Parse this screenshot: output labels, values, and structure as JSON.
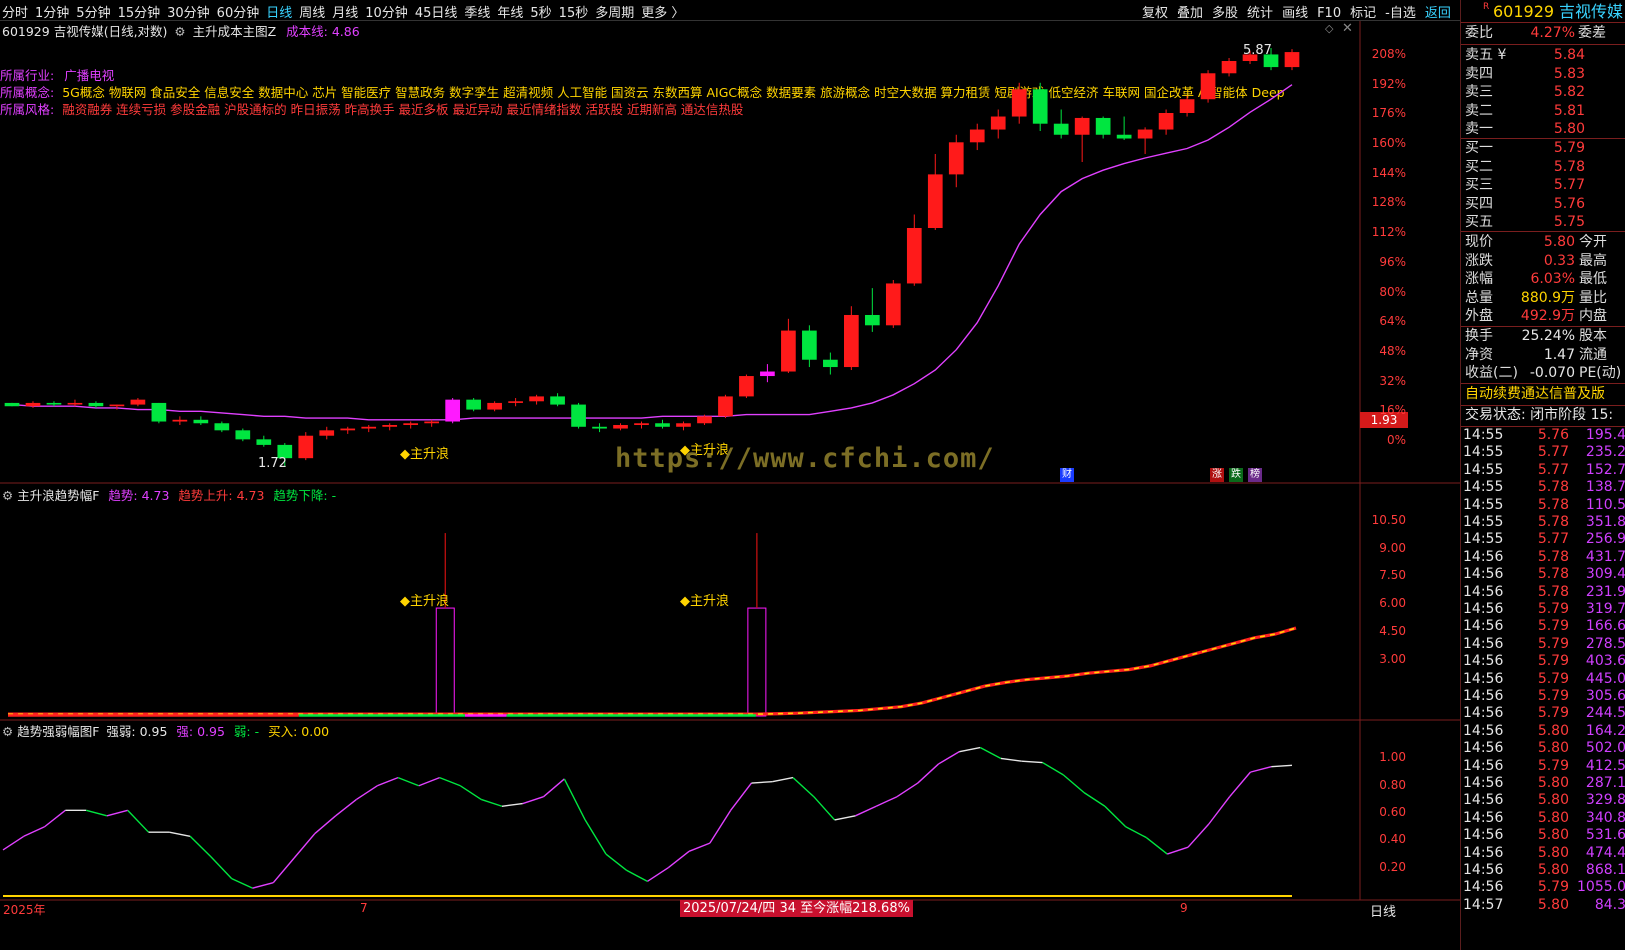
{
  "toolbar": {
    "periods": [
      "分时",
      "1分钟",
      "5分钟",
      "15分钟",
      "30分钟",
      "60分钟",
      "日线",
      "周线",
      "月线",
      "10分钟",
      "45日线",
      "季线",
      "年线",
      "5秒",
      "15秒",
      "多周期",
      "更多 〉"
    ],
    "active_period": "日线",
    "tools": [
      "复权",
      "叠加",
      "多股",
      "统计",
      "画线",
      "F10",
      "标记",
      "-自选",
      "返回"
    ]
  },
  "main_chart": {
    "stock_line": "601929 吉视传媒(日线,对数)",
    "indicator": "主升成本主图Z",
    "cost_label": "成本线: 4.86",
    "industry_label": "所属行业:",
    "industry_value": "广播电视",
    "concept_label": "所属概念:",
    "concept_value": "5G概念 物联网 食品安全 信息安全 数据中心 芯片 智能医疗 智慧政务 数字孪生 超清视频 人工智能 国资云 东数西算 AIGC概念 数据要素 旅游概念 时空大数据 算力租赁 短剧游戏 低空经济 车联网 国企改革 AI智能体 Deep",
    "style_label": "所属风格:",
    "style_value": "融资融券 连续亏损 参股金融 沪股通标的 昨日振荡 昨高换手 最近多板 最近异动 最近情绪指数 活跃股 近期新高 通达信热股",
    "high_label": "5.87",
    "low_label": "1.72",
    "signal_label": "主升浪",
    "watermark": "https://www.cfchi.com/",
    "current_price_tag": "1.93",
    "markers": [
      "财",
      "涨",
      "跌",
      "榜"
    ],
    "axis": [
      "208%",
      "192%",
      "176%",
      "160%",
      "144%",
      "128%",
      "112%",
      "96%",
      "80%",
      "64%",
      "48%",
      "32%",
      "16%",
      "0%"
    ]
  },
  "chart_data": [
    {
      "type": "candlestick",
      "title": "601929 吉视传媒(日线,对数)",
      "series": [
        {
          "name": "成本线",
          "values": [
            2.06,
            2.05,
            2.05,
            2.05,
            2.04,
            2.04,
            2.03,
            2.03,
            2.02,
            2.02,
            2.01,
            2.0,
            1.99,
            1.99,
            1.98,
            1.98,
            1.98,
            1.97,
            1.97,
            1.97,
            1.97,
            1.97,
            1.98,
            1.98,
            1.98,
            1.98,
            1.98,
            1.98,
            1.98,
            1.98,
            1.98,
            1.99,
            1.99,
            1.99,
            1.99,
            2.0,
            2.0,
            2.0,
            2.0,
            2.02,
            2.04,
            2.07,
            2.12,
            2.19,
            2.28,
            2.42,
            2.62,
            2.92,
            3.3,
            3.6,
            3.85,
            4.0,
            4.1,
            4.18,
            4.25,
            4.31,
            4.37,
            4.48,
            4.65,
            4.86,
            5.05,
            5.27
          ]
        }
      ],
      "ohlc": [
        [
          2.07,
          2.07,
          2.05,
          2.05
        ],
        [
          2.05,
          2.08,
          2.04,
          2.07
        ],
        [
          2.07,
          2.08,
          2.05,
          2.06
        ],
        [
          2.06,
          2.09,
          2.05,
          2.07
        ],
        [
          2.07,
          2.08,
          2.04,
          2.05
        ],
        [
          2.05,
          2.06,
          2.03,
          2.06
        ],
        [
          2.06,
          2.1,
          2.05,
          2.09
        ],
        [
          2.07,
          2.07,
          1.95,
          1.96
        ],
        [
          1.96,
          1.99,
          1.94,
          1.97
        ],
        [
          1.97,
          1.99,
          1.94,
          1.95
        ],
        [
          1.95,
          1.96,
          1.9,
          1.91
        ],
        [
          1.91,
          1.92,
          1.85,
          1.86
        ],
        [
          1.86,
          1.88,
          1.82,
          1.83
        ],
        [
          1.83,
          1.84,
          1.72,
          1.76
        ],
        [
          1.76,
          1.9,
          1.75,
          1.88
        ],
        [
          1.88,
          1.93,
          1.86,
          1.91
        ],
        [
          1.91,
          1.93,
          1.89,
          1.92
        ],
        [
          1.92,
          1.94,
          1.9,
          1.93
        ],
        [
          1.93,
          1.95,
          1.91,
          1.94
        ],
        [
          1.94,
          1.96,
          1.92,
          1.95
        ],
        [
          1.95,
          1.97,
          1.93,
          1.96
        ],
        [
          1.96,
          2.1,
          1.95,
          2.09
        ],
        [
          2.09,
          2.1,
          2.02,
          2.03
        ],
        [
          2.03,
          2.08,
          2.02,
          2.07
        ],
        [
          2.07,
          2.1,
          2.05,
          2.08
        ],
        [
          2.08,
          2.12,
          2.06,
          2.11
        ],
        [
          2.11,
          2.13,
          2.05,
          2.06
        ],
        [
          2.06,
          2.07,
          1.92,
          1.93
        ],
        [
          1.93,
          1.95,
          1.9,
          1.92
        ],
        [
          1.92,
          1.95,
          1.91,
          1.94
        ],
        [
          1.94,
          1.96,
          1.92,
          1.95
        ],
        [
          1.95,
          1.97,
          1.92,
          1.93
        ],
        [
          1.93,
          1.96,
          1.91,
          1.95
        ],
        [
          1.95,
          2.0,
          1.94,
          1.99
        ],
        [
          1.99,
          2.12,
          1.98,
          2.11
        ],
        [
          2.11,
          2.25,
          2.1,
          2.24
        ],
        [
          2.24,
          2.32,
          2.2,
          2.27
        ],
        [
          2.27,
          2.65,
          2.26,
          2.56
        ],
        [
          2.56,
          2.6,
          2.3,
          2.35
        ],
        [
          2.35,
          2.4,
          2.25,
          2.3
        ],
        [
          2.3,
          2.75,
          2.28,
          2.68
        ],
        [
          2.68,
          2.9,
          2.55,
          2.6
        ],
        [
          2.6,
          2.97,
          2.58,
          2.94
        ],
        [
          2.94,
          3.6,
          2.92,
          3.46
        ],
        [
          3.46,
          4.3,
          3.44,
          4.05
        ],
        [
          4.05,
          4.55,
          3.9,
          4.45
        ],
        [
          4.45,
          4.7,
          4.35,
          4.62
        ],
        [
          4.62,
          4.9,
          4.5,
          4.8
        ],
        [
          4.8,
          5.3,
          4.7,
          5.2
        ],
        [
          5.2,
          5.3,
          4.6,
          4.7
        ],
        [
          4.7,
          4.9,
          4.5,
          4.55
        ],
        [
          4.55,
          4.8,
          4.2,
          4.78
        ],
        [
          4.78,
          4.8,
          4.5,
          4.55
        ],
        [
          4.55,
          4.8,
          4.48,
          4.5
        ],
        [
          4.5,
          4.65,
          4.3,
          4.62
        ],
        [
          4.62,
          4.9,
          4.55,
          4.85
        ],
        [
          4.85,
          5.1,
          4.8,
          5.05
        ],
        [
          5.05,
          5.5,
          5.0,
          5.45
        ],
        [
          5.45,
          5.7,
          5.4,
          5.65
        ],
        [
          5.65,
          5.82,
          5.6,
          5.76
        ],
        [
          5.76,
          5.87,
          5.5,
          5.55
        ],
        [
          5.55,
          5.85,
          5.5,
          5.8
        ]
      ],
      "ylim": [
        1.72,
        5.87
      ]
    },
    {
      "type": "bar",
      "title": "主升浪趋势幅F",
      "series": [
        {
          "name": "趋势",
          "values": [
            0.1,
            0.1,
            0.1,
            0.1,
            0.1,
            0.1,
            0.1,
            0.1,
            0.1,
            0.1,
            0.1,
            0.1,
            0.1,
            0.1,
            0.1,
            0.1,
            0.1,
            0.1,
            0.1,
            0.1,
            0.1,
            5.8,
            0.1,
            0.1,
            0.1,
            0.1,
            0.1,
            0.1,
            0.1,
            0.1,
            0.1,
            0.1,
            0.1,
            0.1,
            0.1,
            0.1,
            5.8,
            0.12,
            0.15,
            0.2,
            0.25,
            0.3,
            0.4,
            0.5,
            0.7,
            1.0,
            1.3,
            1.6,
            1.8,
            1.95,
            2.05,
            2.15,
            2.3,
            2.4,
            2.5,
            2.7,
            3.0,
            3.3,
            3.6,
            3.9,
            4.2,
            4.4,
            4.73
          ]
        }
      ],
      "ylim": [
        0,
        11.5
      ],
      "yticks": [
        "10.50",
        "9.00",
        "7.50",
        "6.00",
        "4.50",
        "3.00"
      ]
    },
    {
      "type": "line",
      "title": "趋势强弱幅图F",
      "series": [
        {
          "name": "强弱",
          "values": [
            0.33,
            0.43,
            0.5,
            0.62,
            0.62,
            0.58,
            0.62,
            0.46,
            0.46,
            0.43,
            0.28,
            0.12,
            0.05,
            0.09,
            0.27,
            0.45,
            0.58,
            0.7,
            0.8,
            0.86,
            0.8,
            0.86,
            0.8,
            0.7,
            0.65,
            0.67,
            0.72,
            0.85,
            0.55,
            0.3,
            0.18,
            0.1,
            0.2,
            0.32,
            0.38,
            0.62,
            0.82,
            0.83,
            0.86,
            0.72,
            0.55,
            0.58,
            0.65,
            0.72,
            0.82,
            0.96,
            1.05,
            1.08,
            1.0,
            0.98,
            0.97,
            0.88,
            0.75,
            0.65,
            0.5,
            0.42,
            0.3,
            0.35,
            0.52,
            0.72,
            0.9,
            0.94,
            0.95
          ]
        }
      ],
      "ylim": [
        0,
        1.15
      ],
      "yticks": [
        "1.00",
        "0.80",
        "0.60",
        "0.40",
        "0.20"
      ]
    }
  ],
  "panel2": {
    "title": "主升浪趋势幅F",
    "trend_label": "趋势: 4.73",
    "up_label": "趋势上升: 4.73",
    "down_label": "趋势下降: -",
    "signal_label": "主升浪"
  },
  "panel3": {
    "title": "趋势强弱幅图F",
    "strength_label": "强弱: 0.95",
    "strong_label": "强: 0.95",
    "weak_label": "弱: -",
    "buy_label": "买入: 0.00"
  },
  "bottom": {
    "year_label": "2025年",
    "m7": "7",
    "m9": "9",
    "date_banner": "2025/07/24/四 34 至今涨幅218.68%",
    "period_label": "日线"
  },
  "quote": {
    "code": "601929",
    "name": "吉视传媒",
    "r_badge": "R",
    "weibi_label": "委比",
    "weibi_value": "4.27%",
    "weicha_label": "委差",
    "asks": [
      {
        "label": "卖五 ¥",
        "price": "5.84"
      },
      {
        "label": "卖四",
        "price": "5.83"
      },
      {
        "label": "卖三",
        "price": "5.82"
      },
      {
        "label": "卖二",
        "price": "5.81"
      },
      {
        "label": "卖一",
        "price": "5.80"
      }
    ],
    "bids": [
      {
        "label": "买一",
        "price": "5.79"
      },
      {
        "label": "买二",
        "price": "5.78"
      },
      {
        "label": "买三",
        "price": "5.77"
      },
      {
        "label": "买四",
        "price": "5.76"
      },
      {
        "label": "买五",
        "price": "5.75"
      }
    ],
    "stats": [
      {
        "k": "现价",
        "v": "5.80",
        "k2": "今开",
        "color": "#ff3b3b"
      },
      {
        "k": "涨跌",
        "v": "0.33",
        "k2": "最高",
        "color": "#ff3b3b"
      },
      {
        "k": "涨幅",
        "v": "6.03%",
        "k2": "最低",
        "color": "#ff3b3b"
      },
      {
        "k": "总量",
        "v": "880.9万",
        "k2": "量比",
        "color": "#ffd400"
      },
      {
        "k": "外盘",
        "v": "492.9万",
        "k2": "内盘",
        "color": "#ff3b3b"
      }
    ],
    "stats2": [
      {
        "k": "换手",
        "v": "25.24%",
        "k2": "股本"
      },
      {
        "k": "净资",
        "v": "1.47",
        "k2": "流通"
      },
      {
        "k": "收益(二)",
        "v": "-0.070",
        "k2": "PE(动)"
      }
    ],
    "promo": "自动续费通达信普及版",
    "status": "交易状态: 闭市阶段 15:",
    "ticks": [
      {
        "t": "14:55",
        "p": "5.76",
        "q": "195.4",
        "qc": "#d040ff"
      },
      {
        "t": "14:55",
        "p": "5.77",
        "q": "235.2",
        "qc": "#d040ff"
      },
      {
        "t": "14:55",
        "p": "5.77",
        "q": "152.7",
        "qc": "#d040ff"
      },
      {
        "t": "14:55",
        "p": "5.78",
        "q": "138.7",
        "qc": "#d040ff"
      },
      {
        "t": "14:55",
        "p": "5.78",
        "q": "110.5",
        "qc": "#d040ff"
      },
      {
        "t": "14:55",
        "p": "5.78",
        "q": "351.8",
        "qc": "#d040ff"
      },
      {
        "t": "14:55",
        "p": "5.77",
        "q": "256.9",
        "qc": "#d040ff"
      },
      {
        "t": "14:56",
        "p": "5.78",
        "q": "431.7",
        "qc": "#d040ff"
      },
      {
        "t": "14:56",
        "p": "5.78",
        "q": "309.4",
        "qc": "#d040ff"
      },
      {
        "t": "14:56",
        "p": "5.78",
        "q": "231.9",
        "qc": "#d040ff"
      },
      {
        "t": "14:56",
        "p": "5.79",
        "q": "319.7",
        "qc": "#d040ff"
      },
      {
        "t": "14:56",
        "p": "5.79",
        "q": "166.6",
        "qc": "#d040ff"
      },
      {
        "t": "14:56",
        "p": "5.79",
        "q": "278.5",
        "qc": "#d040ff"
      },
      {
        "t": "14:56",
        "p": "5.79",
        "q": "403.6",
        "qc": "#d040ff"
      },
      {
        "t": "14:56",
        "p": "5.79",
        "q": "445.0",
        "qc": "#d040ff"
      },
      {
        "t": "14:56",
        "p": "5.79",
        "q": "305.6",
        "qc": "#d040ff"
      },
      {
        "t": "14:56",
        "p": "5.79",
        "q": "244.5",
        "qc": "#d040ff"
      },
      {
        "t": "14:56",
        "p": "5.80",
        "q": "164.2",
        "qc": "#d040ff"
      },
      {
        "t": "14:56",
        "p": "5.80",
        "q": "502.0",
        "qc": "#d040ff"
      },
      {
        "t": "14:56",
        "p": "5.79",
        "q": "412.5",
        "qc": "#d040ff"
      },
      {
        "t": "14:56",
        "p": "5.80",
        "q": "287.1",
        "qc": "#d040ff"
      },
      {
        "t": "14:56",
        "p": "5.80",
        "q": "329.8",
        "qc": "#d040ff"
      },
      {
        "t": "14:56",
        "p": "5.80",
        "q": "340.8",
        "qc": "#d040ff"
      },
      {
        "t": "14:56",
        "p": "5.80",
        "q": "531.6",
        "qc": "#d040ff"
      },
      {
        "t": "14:56",
        "p": "5.80",
        "q": "474.4",
        "qc": "#d040ff"
      },
      {
        "t": "14:56",
        "p": "5.80",
        "q": "868.1",
        "qc": "#d040ff"
      },
      {
        "t": "14:56",
        "p": "5.79",
        "q": "1055.0",
        "qc": "#d040ff"
      },
      {
        "t": "14:57",
        "p": "5.80",
        "q": "84.3",
        "qc": "#d040ff"
      }
    ]
  },
  "colors": {
    "up": "#ff1a1a",
    "down": "#00e640",
    "cost": "#e040ff",
    "axis": "#ff3b3b",
    "grid": "#7a1e1e",
    "signal": "#ffd400"
  }
}
